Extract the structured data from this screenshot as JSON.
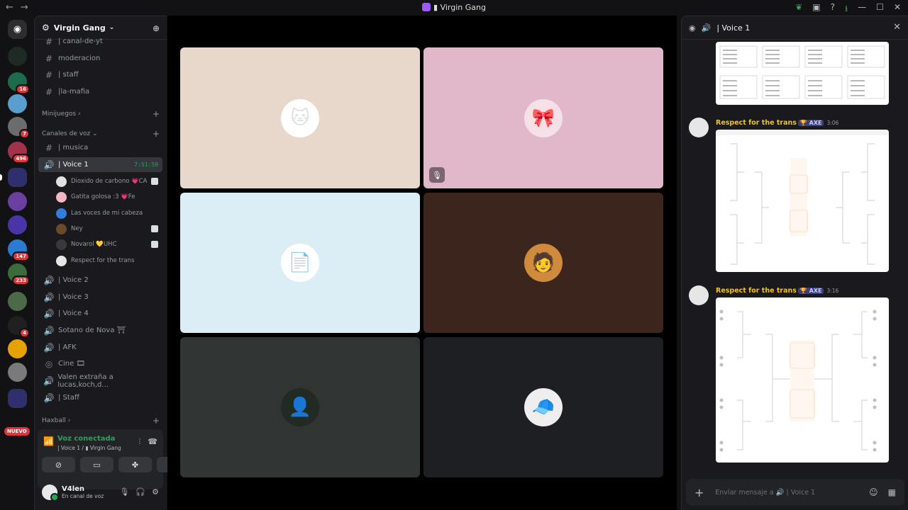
{
  "titlebar": {
    "title": "Virgin Gang",
    "prefix": "▮"
  },
  "servers": {
    "badges": [
      "16",
      "7",
      "496",
      "147",
      "233",
      "4"
    ],
    "nuevo": "NUEVO"
  },
  "guild": {
    "name": "Virgin Gang"
  },
  "channels": [
    {
      "name": "| canal-de-yt",
      "type": "text"
    },
    {
      "name": "moderacion",
      "type": "text"
    },
    {
      "name": "| staff",
      "type": "text"
    },
    {
      "name": "|la-mafia",
      "type": "text"
    }
  ],
  "categories": {
    "minijuegos": "Minijuegos ›",
    "voz": "Canales de voz ⌄",
    "haxball": "Haxball ›"
  },
  "voice_channels": [
    {
      "name": "| musica",
      "type": "text"
    },
    {
      "name": "| Voice 1",
      "timer": "7:51:59",
      "active": true
    },
    {
      "name": "| Voice 2"
    },
    {
      "name": "| Voice 3"
    },
    {
      "name": "| Voice 4"
    },
    {
      "name": "Sotano de Nova ⛩"
    },
    {
      "name": "| AFK"
    },
    {
      "name": "Cine 🎞"
    },
    {
      "name": "Valen extraña a lucas,koch,d..."
    },
    {
      "name": "| Staff"
    }
  ],
  "members": [
    {
      "name": "Dioxido de carbono",
      "suffix": "💗CA",
      "color": "#e0e0e0"
    },
    {
      "name": "Gatita golosa :3",
      "suffix": "💗Fe",
      "color": "#f4b6c2"
    },
    {
      "name": "Las voces de mi cabeza",
      "suffix": "",
      "color": "#2f7ddc"
    },
    {
      "name": "Ney",
      "suffix": "",
      "color": "#6b4a2a"
    },
    {
      "name": "Novarol",
      "suffix": "💛UHC",
      "color": "#3a3a3a"
    },
    {
      "name": "Respect for the trans",
      "suffix": "",
      "color": "#e6e6e6"
    }
  ],
  "voice_status": {
    "label": "Voz conectada",
    "sub": "| Voice 1 / ▮ Virgin Gang"
  },
  "user": {
    "name": "V4len",
    "status": "En canal de voz"
  },
  "tiles": [
    {
      "bg": "#e8d8cc",
      "avatar_bg": "#ffffff",
      "glyph": "🐱"
    },
    {
      "bg": "#e0b8c9",
      "avatar_bg": "#f5e0e8",
      "glyph": "🎀",
      "muted": true
    },
    {
      "bg": "#dbedf5",
      "avatar_bg": "#ffffff",
      "glyph": "📄"
    },
    {
      "bg": "#3b251d",
      "avatar_bg": "#d08a3c",
      "glyph": "🧑"
    },
    {
      "bg": "#303533",
      "avatar_bg": "#222a24",
      "glyph": "👤"
    },
    {
      "bg": "#1e1f22",
      "avatar_bg": "#eeeeee",
      "glyph": "🧢"
    }
  ],
  "panel": {
    "title": "| Voice 1",
    "messages": [
      {
        "author": "Respect for the trans",
        "tag": "🏆 AXE",
        "time": "3:06"
      },
      {
        "author": "Respect for the trans",
        "tag": "🏆 AXE",
        "time": "3:16"
      }
    ],
    "composer_placeholder": "Enviar mensaje a 🔊 | Voice 1"
  }
}
